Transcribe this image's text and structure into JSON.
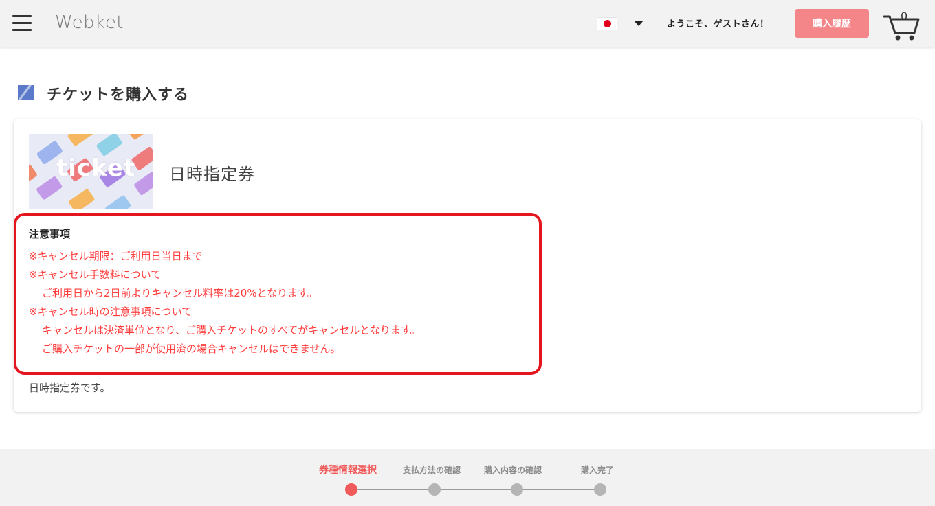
{
  "header": {
    "logo": "Webket",
    "welcome": "ようこそ、ゲストさん！",
    "history_button": "購入履歴",
    "cart_count": "0"
  },
  "page": {
    "title": "チケットを購入する"
  },
  "ticket": {
    "image_text": "ticket",
    "name": "日時指定券",
    "description": "日時指定券です。",
    "notice_heading": "注意事項",
    "notice_lines": [
      "※キャンセル期限：ご利用日当日まで",
      "※キャンセル手数料について",
      "ご利用日から2日前よりキャンセル料率は20%となります。",
      "※キャンセル時の注意事項について",
      "キャンセルは決済単位となり、ご購入チケットのすべてがキャンセルとなります。",
      "ご購入チケットの一部が使用済の場合キャンセルはできません。"
    ]
  },
  "steps": [
    {
      "label": "券種情報選択",
      "active": true
    },
    {
      "label": "支払方法の確認",
      "active": false
    },
    {
      "label": "購入内容の確認",
      "active": false
    },
    {
      "label": "購入完了",
      "active": false
    }
  ],
  "colors": {
    "accent": "#f05a5a",
    "history_button": "#f4868a",
    "notice_border": "#e4151f",
    "notice_text": "#ff3d3d",
    "title_icon": "#5b7ac9"
  }
}
